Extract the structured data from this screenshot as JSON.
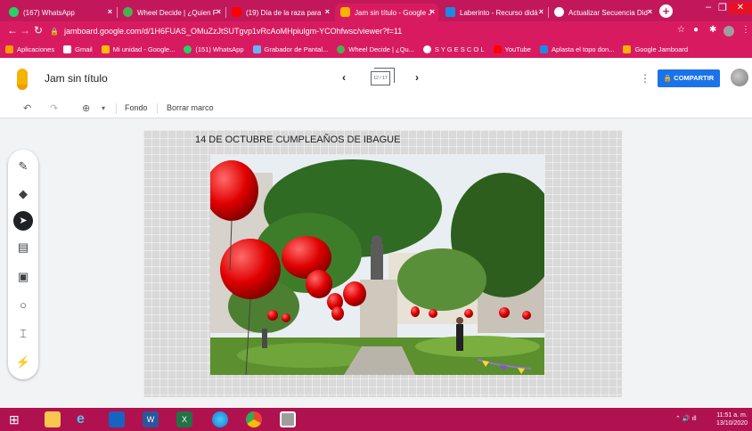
{
  "browser": {
    "tabs": [
      {
        "label": "(167) WhatsApp",
        "icon": "whatsapp-icon",
        "color": "#25d366"
      },
      {
        "label": "Wheel Decide | ¿Quien F",
        "icon": "wheel-icon",
        "color": "#4caf50"
      },
      {
        "label": "(19) Día de la raza para",
        "icon": "youtube-icon",
        "color": "#ff0000"
      },
      {
        "label": "Jam sin título - Google J",
        "icon": "jamboard-icon",
        "color": "#f4b400",
        "active": true
      },
      {
        "label": "Laberinto - Recurso didá",
        "icon": "laberinto-icon",
        "color": "#1e88e5"
      },
      {
        "label": "Actualizar Secuencia Did",
        "icon": "sygescol-icon",
        "color": "#ffffff"
      }
    ],
    "url": "jamboard.google.com/d/1H6FUAS_OMuZzJtSUTgvp1vRcAoMHpiulgm-YCOhfwsc/viewer?f=11",
    "bookmarks": [
      {
        "label": "Aplicaciones",
        "color": "#ff9800"
      },
      {
        "label": "Gmail",
        "color": "#ffffff"
      },
      {
        "label": "Mi unidad - Google...",
        "color": "#fbbc04"
      },
      {
        "label": "(151) WhatsApp",
        "color": "#25d366"
      },
      {
        "label": "Grabador de Pantal...",
        "color": "#64b5f6"
      },
      {
        "label": "Wheel Decide | ¿Qu...",
        "color": "#4caf50"
      },
      {
        "label": "S Y G E S C O L",
        "color": "#ffffff"
      },
      {
        "label": "YouTube",
        "color": "#ff0000"
      },
      {
        "label": "Aplasta el topo don...",
        "color": "#1e88e5"
      },
      {
        "label": "Google Jamboard",
        "color": "#f4b400"
      }
    ]
  },
  "jamboard": {
    "title": "Jam sin título",
    "frame_indicator": "12 / 17",
    "share_label": "COMPARTIR",
    "toolbar": {
      "background_label": "Fondo",
      "clear_label": "Borrar marco"
    },
    "side_tools": [
      "pen-icon",
      "eraser-icon",
      "select-icon",
      "sticky-note-icon",
      "image-icon",
      "circle-icon",
      "text-box-icon",
      "laser-icon"
    ],
    "canvas": {
      "title": "14 DE OCTUBRE CUMPLEAÑOS DE IBAGUE"
    }
  },
  "taskbar": {
    "time": "11:51 a. m.",
    "date": "13/10/2020",
    "apps": [
      "windows-start-icon",
      "file-explorer-icon",
      "internet-explorer-icon",
      "media-player-icon",
      "word-icon",
      "excel-icon",
      "edge-icon",
      "chrome-icon",
      "chrome-profile-icon"
    ]
  }
}
